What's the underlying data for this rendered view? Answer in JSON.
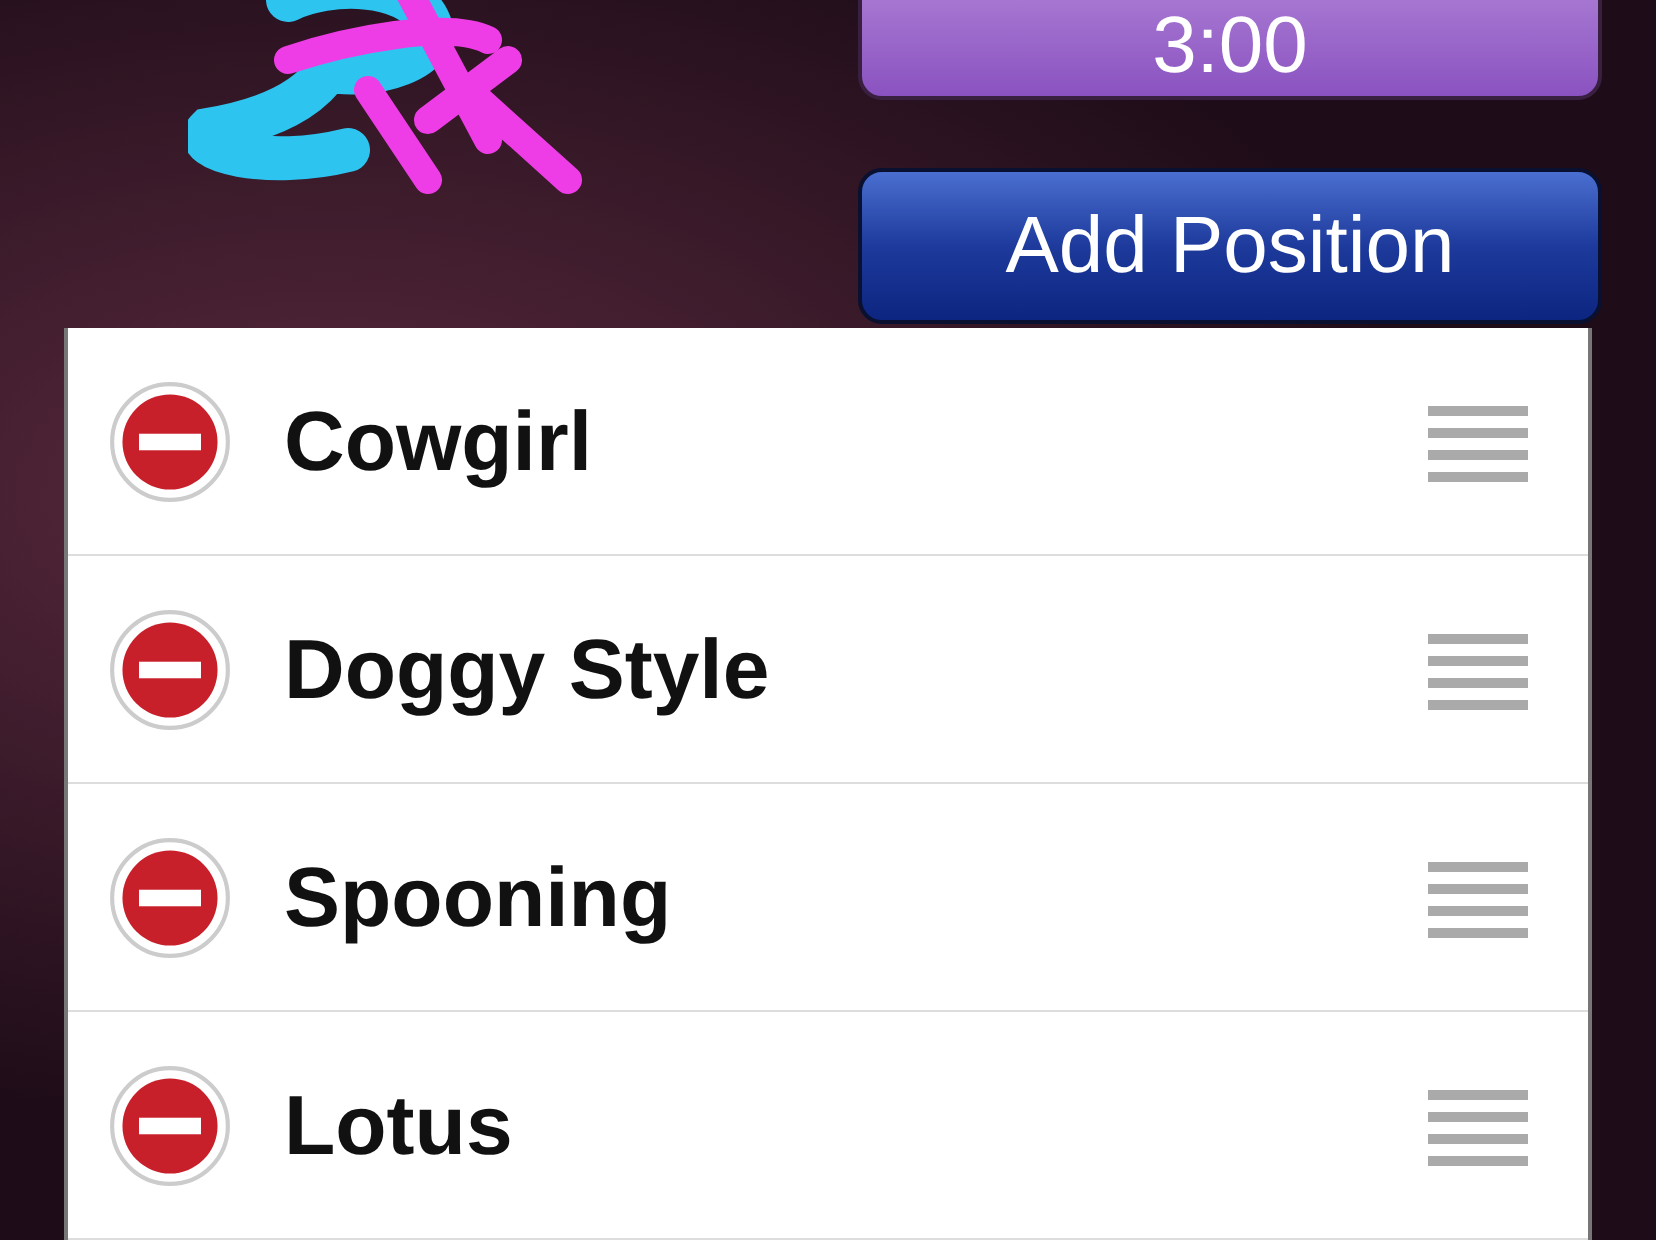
{
  "timer": {
    "label": "3:00"
  },
  "add_button": {
    "label": "Add Position"
  },
  "positions": [
    {
      "name": "Cowgirl"
    },
    {
      "name": "Doggy Style"
    },
    {
      "name": "Spooning"
    },
    {
      "name": "Lotus"
    }
  ]
}
